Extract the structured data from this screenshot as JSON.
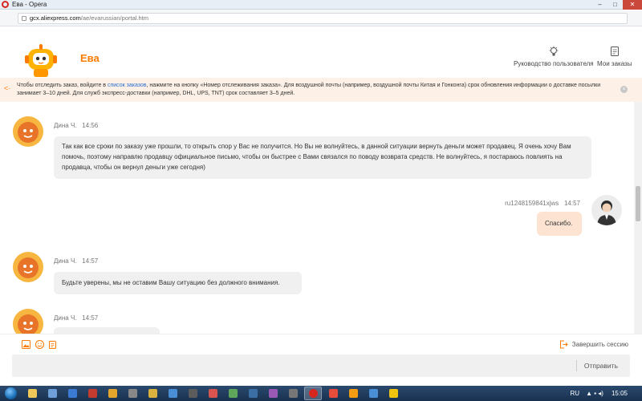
{
  "window": {
    "title": "Ева - Opera",
    "min": "–",
    "max": "□",
    "close": "✕"
  },
  "address": {
    "domain": "gcx.aliexpress.com",
    "path": "/ae/evarussian/portal.htm"
  },
  "header": {
    "bot_name": "Ева",
    "guide_label": "Руководство пользователя",
    "orders_label": "Мои заказы"
  },
  "notice": {
    "text_before": "Чтобы отследить заказ, войдите в ",
    "link": "список заказов",
    "text_after": ", нажмите на кнопку «Номер отслеживания заказа». Для воздушной почты (например, воздушной почты Китая и Гонконга) срок обновления информации о доставке посылки занимает 3–10 дней. Для служб экспресс-доставки (например, DHL, UPS, TNT) срок составляет 3–5 дней.",
    "close": "×"
  },
  "messages": [
    {
      "sender": "Дина Ч.",
      "time": "14:56",
      "text": "Так как все сроки по заказу уже прошли, то открыть спор у Вас не получится. Но Вы не волнуйтесь, в данной ситуации вернуть деньги может продавец. Я очень хочу Вам помочь, поэтому направлю продавцу официальное письмо, чтобы он быстрее с Вами связался по поводу возврата средств. Не волнуйтесь, я постараюсь повлиять на продавца, чтобы он вернул деньги уже сегодня)"
    },
    {
      "sender": "ru1248159841xjws",
      "time": "14:57",
      "text": "Спасибо."
    },
    {
      "sender": "Дина Ч.",
      "time": "14:57",
      "text": "Будьте уверены, мы не оставим Вашу ситуацию без должного внимания."
    },
    {
      "sender": "Дина Ч.",
      "time": "14:57",
      "text": ""
    }
  ],
  "footer": {
    "end_session": "Завершить сессию",
    "send": "Отправить"
  },
  "taskbar": {
    "lang": "RU",
    "time": "15:05"
  },
  "colors": {
    "accent": "#ff7a00",
    "link": "#2b6fd1",
    "notice_bg": "#fdf1e7",
    "user_bubble": "#fde4d2"
  },
  "icons": {
    "image": "image-icon",
    "emoji": "smile-icon",
    "history": "clipboard-icon",
    "exit": "exit-icon",
    "guide": "lightbulb-icon",
    "orders": "orders-icon"
  }
}
